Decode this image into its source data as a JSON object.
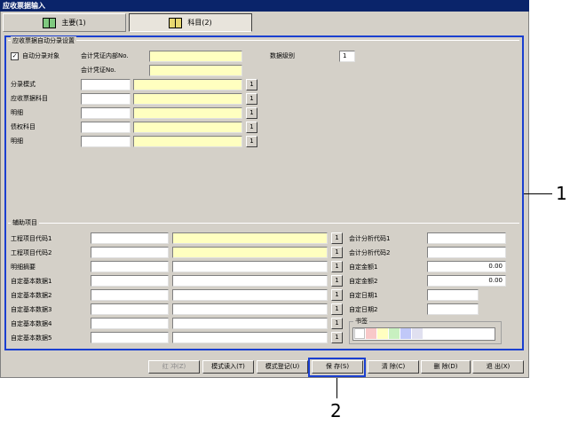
{
  "window": {
    "title": "应收票据输入"
  },
  "tabs": [
    {
      "label": "主要(1)"
    },
    {
      "label": "科目(2)"
    }
  ],
  "auto_section": {
    "title": "应收票据自动分录设置",
    "auto_checkbox_label": "自动分录对象",
    "auto_checked": "✓",
    "voucher_internal_label": "会计凭证内部No.",
    "voucher_no_label": "会计凭证No.",
    "data_level_label": "数据级别",
    "data_level_value": "1",
    "rows": [
      {
        "label": "分录模式",
        "btn": "1"
      },
      {
        "label": "应收票据科目",
        "btn": "1"
      },
      {
        "label": "明细",
        "btn": "1"
      },
      {
        "label": "债权科目",
        "btn": "1"
      },
      {
        "label": "明细",
        "btn": "1"
      }
    ]
  },
  "aux_section": {
    "title": "辅助项目",
    "rows": [
      {
        "label": "工程项目代码1",
        "btn": "1"
      },
      {
        "label": "工程项目代码2",
        "btn": "1"
      },
      {
        "label": "明细摘要",
        "btn": "1"
      },
      {
        "label": "自定基本数据1",
        "btn": "1"
      },
      {
        "label": "自定基本数据2",
        "btn": "1"
      },
      {
        "label": "自定基本数据3",
        "btn": "1"
      },
      {
        "label": "自定基本数据4",
        "btn": "1"
      },
      {
        "label": "自定基本数据5",
        "btn": "1"
      }
    ],
    "right_rows": [
      {
        "label": "会计分析代码1",
        "value": ""
      },
      {
        "label": "会计分析代码2",
        "value": ""
      },
      {
        "label": "自定金额1",
        "value": "0.00"
      },
      {
        "label": "自定金额2",
        "value": "0.00"
      },
      {
        "label": "自定日期1",
        "value": ""
      },
      {
        "label": "自定日期2",
        "value": ""
      }
    ],
    "bookmark_label": "书签",
    "bookmark_colors": [
      "#ffffff",
      "#f8c8c8",
      "#ffffc0",
      "#c8f0c0",
      "#c0c8f8",
      "#e0e0f0"
    ]
  },
  "buttons": {
    "red_book": "红 冲(Z)",
    "mode_read": "模式读入(T)",
    "mode_register": "模式登记(U)",
    "save": "保 存(S)",
    "clear": "清 除(C)",
    "delete": "删 除(D)",
    "exit": "退 出(X)"
  },
  "callouts": {
    "one": "1",
    "two": "2"
  },
  "colors": {
    "title_bar": "#0a246a",
    "highlight_frame": "#1a3fd0",
    "required_field": "#ffffc0"
  }
}
